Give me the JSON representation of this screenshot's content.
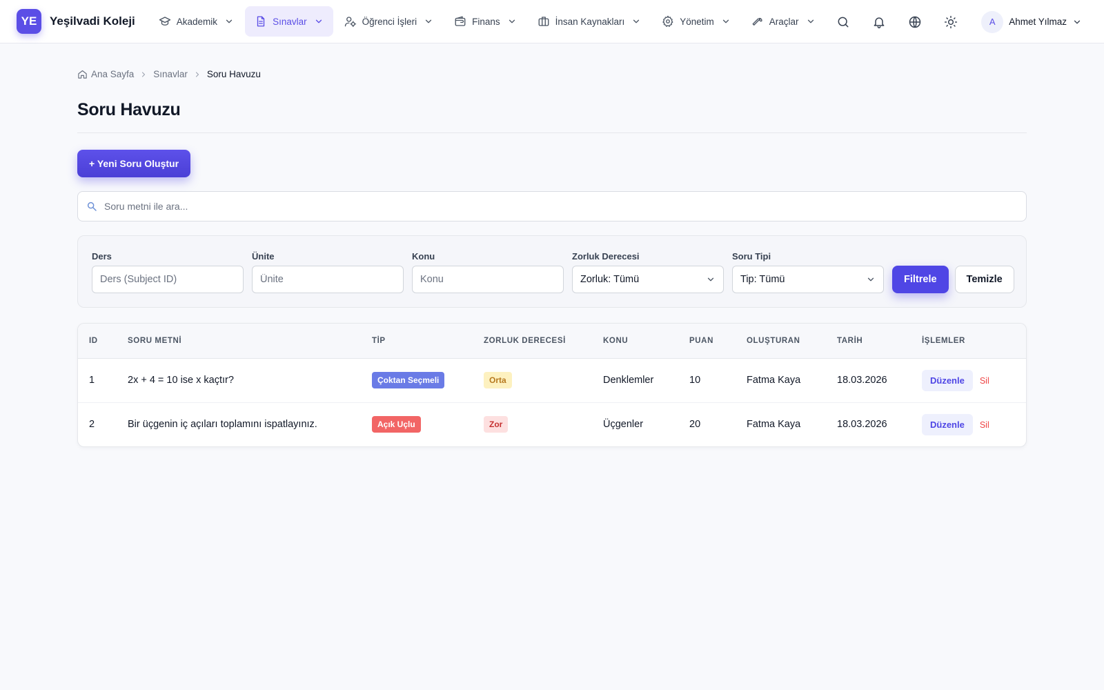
{
  "brand": {
    "logo": "YE",
    "name": "Yeşilvadi Koleji"
  },
  "nav": [
    {
      "label": "Akademik",
      "icon": "graduation-cap-icon"
    },
    {
      "label": "Sınavlar",
      "icon": "document-icon",
      "active": true
    },
    {
      "label": "Öğrenci İşleri",
      "icon": "users-icon"
    },
    {
      "label": "Finans",
      "icon": "wallet-icon"
    },
    {
      "label": "İnsan Kaynakları",
      "icon": "briefcase-icon"
    },
    {
      "label": "Yönetim",
      "icon": "gear-icon"
    },
    {
      "label": "Araçlar",
      "icon": "wrench-icon"
    }
  ],
  "user": {
    "initial": "A",
    "name": "Ahmet Yılmaz"
  },
  "breadcrumb": {
    "home": "Ana Sayfa",
    "section": "Sınavlar",
    "current": "Soru Havuzu"
  },
  "page": {
    "title": "Soru Havuzu",
    "new_button": "+ Yeni Soru Oluştur"
  },
  "search": {
    "placeholder": "Soru metni ile ara..."
  },
  "filters": {
    "ders": {
      "label": "Ders",
      "placeholder": "Ders (Subject ID)"
    },
    "unite": {
      "label": "Ünite",
      "placeholder": "Ünite"
    },
    "konu": {
      "label": "Konu",
      "placeholder": "Konu"
    },
    "zorluk": {
      "label": "Zorluk Derecesi",
      "value": "Zorluk: Tümü"
    },
    "tip": {
      "label": "Soru Tipi",
      "value": "Tip: Tümü"
    },
    "filter_button": "Filtrele",
    "clear_button": "Temizle"
  },
  "table": {
    "headers": [
      "ID",
      "SORU METNİ",
      "TİP",
      "ZORLUK DERECESİ",
      "KONU",
      "PUAN",
      "OLUŞTURAN",
      "TARİH",
      "İŞLEMLER"
    ],
    "edit_label": "Düzenle",
    "delete_label": "Sil",
    "rows": [
      {
        "id": "1",
        "text": "2x + 4 = 10 ise x kaçtır?",
        "type": "Çoktan Seçmeli",
        "type_color": "#6a7be6",
        "difficulty": "Orta",
        "difficulty_color": "#fdf1c0",
        "topic": "Denklemler",
        "points": "10",
        "author": "Fatma Kaya",
        "date": "18.03.2026"
      },
      {
        "id": "2",
        "text": "Bir üçgenin iç açıları toplamını ispatlayınız.",
        "type": "Açık Uçlu",
        "type_color": "#f26565",
        "difficulty": "Zor",
        "difficulty_color": "#fde0e0",
        "topic": "Üçgenler",
        "points": "20",
        "author": "Fatma Kaya",
        "date": "18.03.2026"
      }
    ]
  },
  "colors": {
    "accent": "#5b4ee6",
    "danger": "#ef4444"
  }
}
